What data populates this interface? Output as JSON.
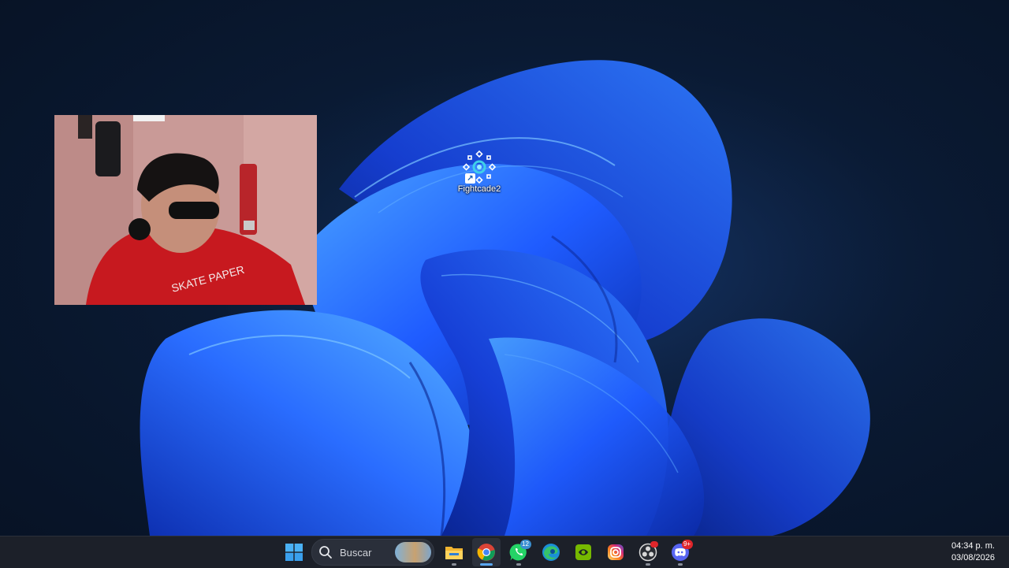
{
  "desktop": {
    "icons": [
      {
        "label": "Fightcade2",
        "icon": "fightcade-icon"
      }
    ]
  },
  "webcam_overlay": {
    "icon": "webcam-person"
  },
  "taskbar": {
    "start_icon": "windows-start-icon",
    "search": {
      "placeholder": "Buscar",
      "icon": "search-icon"
    },
    "apps": [
      {
        "name": "File Explorer",
        "icon": "folder-icon"
      },
      {
        "name": "Google Chrome",
        "icon": "chrome-icon",
        "active": true
      },
      {
        "name": "WhatsApp",
        "icon": "whatsapp-icon",
        "badge": "12"
      },
      {
        "name": "Microsoft Edge",
        "icon": "edge-icon"
      },
      {
        "name": "NVIDIA",
        "icon": "nvidia-icon"
      },
      {
        "name": "Instagram",
        "icon": "instagram-icon"
      },
      {
        "name": "OBS Studio",
        "icon": "obs-icon"
      },
      {
        "name": "Discord",
        "icon": "discord-icon",
        "badge": "9+"
      }
    ],
    "clock": {
      "time": "04:34 p. m.",
      "date": "03/08/2026"
    }
  },
  "colors": {
    "taskbar_bg": "#1c2029",
    "accent": "#5aa7f0",
    "wallpaper_bloom": "#1f5cff"
  }
}
